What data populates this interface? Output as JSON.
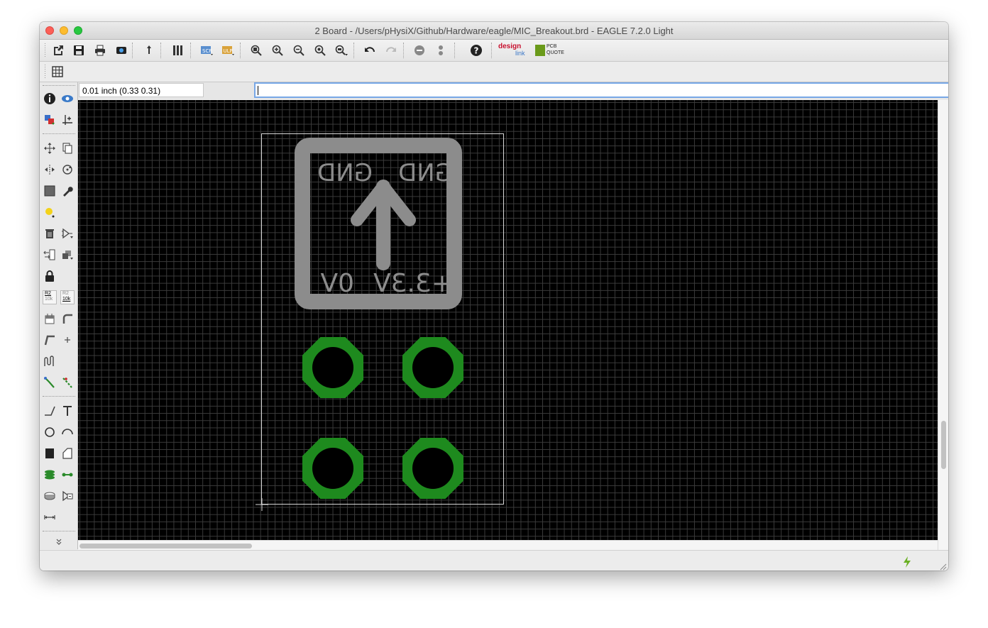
{
  "window": {
    "title": "2 Board - /Users/pHysiX/Github/Hardware/eagle/MIC_Breakout.brd - EAGLE 7.2.0 Light"
  },
  "toolbar": {
    "buttons": [
      "open-icon",
      "save-icon",
      "print-icon",
      "cam-icon",
      "upload-icon",
      "layers-icon",
      "script-icon",
      "run-ulp-icon",
      "zoom-fit-icon",
      "zoom-in-icon",
      "zoom-out-icon",
      "zoom-redraw-icon",
      "zoom-select-icon",
      "undo-icon",
      "redo-icon",
      "stop-icon",
      "go-icon",
      "help-icon",
      "design-link-icon",
      "pcb-quote-icon"
    ],
    "design_link_label": "design",
    "design_link_sub": "link",
    "pcb_quote_label": "PCB",
    "pcb_quote_sub": "QUOTE"
  },
  "command_bar": {
    "coordinate": "0.01 inch (0.33 0.31)",
    "command_value": ""
  },
  "board": {
    "silk_labels": {
      "top_left": "GND",
      "top_right": "GND",
      "bottom_left": "0V",
      "bottom_right": "+3.3V"
    },
    "colors": {
      "silk": "#8c8c8c",
      "pad": "#1e8a1e",
      "outline": "#d8d8d8",
      "grid": "#3b3b3b",
      "background": "#000000"
    }
  },
  "left_tools": {
    "r2_label": "R2",
    "r2_value": "10k"
  }
}
